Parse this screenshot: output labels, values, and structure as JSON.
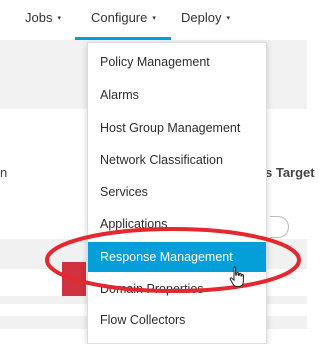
{
  "topnav": {
    "items": [
      {
        "label": "Jobs",
        "caret": "▾"
      },
      {
        "label": "Configure",
        "caret": "▾"
      },
      {
        "label": "Deploy",
        "caret": "▾"
      }
    ],
    "active_index": 1
  },
  "background_table": {
    "left_header_partial": "n",
    "right_header_partial": "s Target"
  },
  "configure_menu": {
    "items": [
      {
        "label": "Policy Management"
      },
      {
        "label": "Alarms"
      },
      {
        "label": "Host Group Management"
      },
      {
        "label": "Network Classification"
      },
      {
        "label": "Services"
      },
      {
        "label": "Applications"
      },
      {
        "label": "Response Management"
      },
      {
        "label": "Domain Properties"
      },
      {
        "label": "Flow Collectors"
      }
    ],
    "selected_index": 6
  },
  "colors": {
    "accent": "#049fd9",
    "annotation_ring": "#e5272f",
    "red_tab": "#d0323f"
  }
}
